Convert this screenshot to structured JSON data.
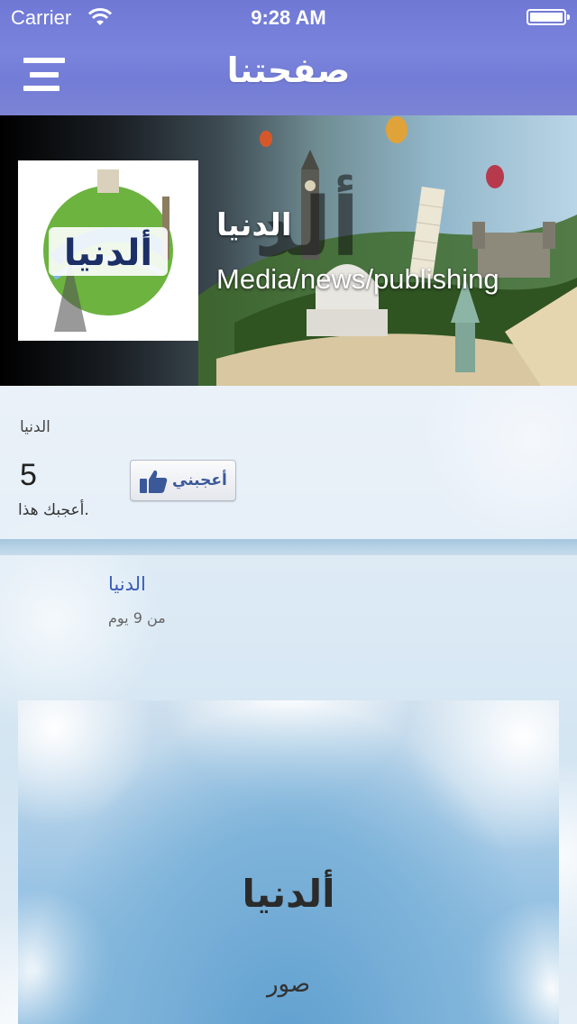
{
  "status_bar": {
    "carrier": "Carrier",
    "time": "9:28 AM"
  },
  "nav": {
    "title": "صفحتنا"
  },
  "cover": {
    "page_name": "الدنيا",
    "category": "Media/news/publishing"
  },
  "like_box": {
    "page_name": "الدنيا",
    "count": "5",
    "caption": "أعجبك هذا.",
    "like_button": "أعجبني"
  },
  "post": {
    "author": "الدنيا",
    "time": "من 9 يوم",
    "image_title": "ألدنيا",
    "image_subtitle": "صور"
  },
  "colors": {
    "nav_bar": "#7079d5",
    "link": "#3b5bb5",
    "facebook": "#3b5998"
  },
  "icons": [
    "wifi-icon",
    "battery-icon",
    "menu-icon",
    "thumbs-up-icon",
    "globe-logo"
  ]
}
